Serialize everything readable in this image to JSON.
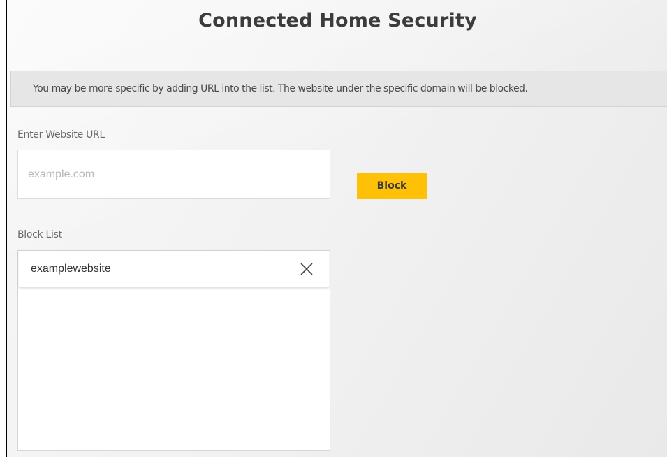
{
  "page": {
    "title": "Connected Home Security",
    "info_text": "You may be more specific by adding URL into the list. The website under the specific domain will be blocked."
  },
  "url_form": {
    "label": "Enter Website URL",
    "value": "",
    "placeholder": "example.com",
    "block_label": "Block",
    "accent_color": "#ffc107"
  },
  "block_list": {
    "label": "Block List",
    "items": [
      {
        "label": "examplewebsite",
        "remove_icon": "close-icon"
      }
    ]
  }
}
